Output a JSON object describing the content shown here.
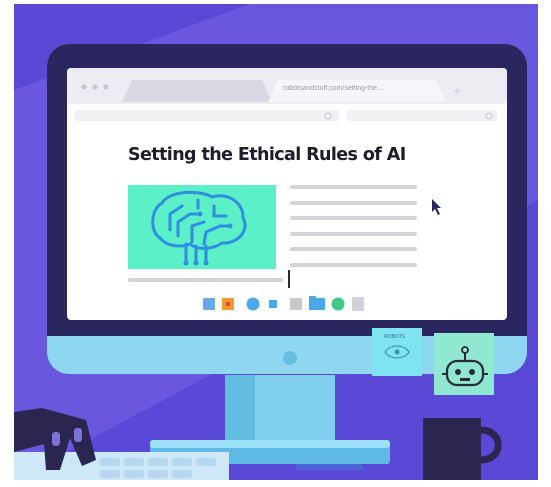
{
  "browser": {
    "tab_active_label": "",
    "tab_inactive_label": "robotsandstuff.com/setting-the...",
    "search_placeholder": ""
  },
  "article": {
    "title": "Setting the Ethical Rules of AI"
  },
  "sticky_note": {
    "label": "ROBOTS"
  },
  "colors": {
    "background_purple": "#5a48d6",
    "monitor_bezel": "#2a2760",
    "monitor_body": "#8fd6f0",
    "brain_panel": "#5cf0c8",
    "brain_icon": "#2f8ee0",
    "text_dark": "#1d1d2b"
  },
  "icons": [
    "monitor-icon",
    "brain-circuit-icon",
    "mouse-cursor-icon",
    "robot-sticky-note-icon",
    "coffee-mug-icon",
    "robot-hand-icon",
    "keyboard-icon"
  ]
}
